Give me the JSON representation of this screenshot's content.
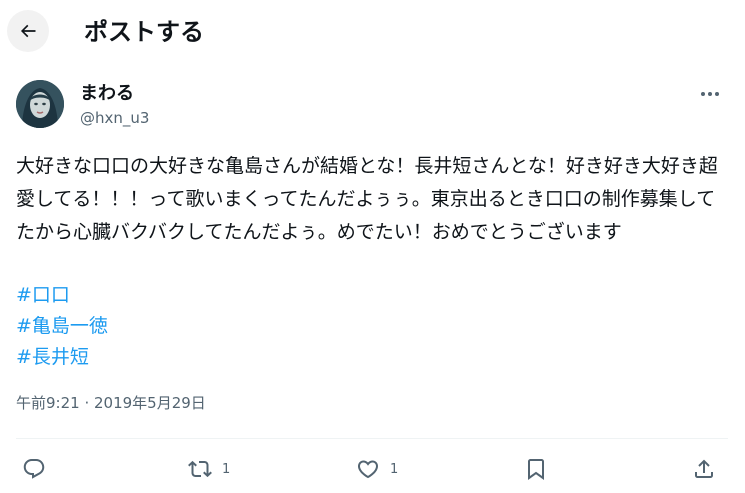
{
  "header": {
    "title": "ポストする",
    "back_icon": "arrow-left-icon"
  },
  "tweet": {
    "display_name": "まわる",
    "handle": "@hxn_u3",
    "text": "大好きな口口の大好きな亀島さんが結婚とな！長井短さんとな！好き好き大好き超愛してる！！！って歌いまくってたんだよぅぅ。東京出るとき口口の制作募集してたから心臓バクバクしてたんだよぅ。めでたい！おめでとうございます",
    "hashtags": [
      "#口口",
      "#亀島一徳",
      "#長井短"
    ],
    "timestamp": "午前9:21 · 2019年5月29日"
  },
  "actions": {
    "reply": {
      "icon": "reply-icon",
      "count": ""
    },
    "repost": {
      "icon": "repost-icon",
      "count": "1"
    },
    "like": {
      "icon": "heart-icon",
      "count": "1"
    },
    "bookmark": {
      "icon": "bookmark-icon",
      "count": ""
    },
    "share": {
      "icon": "share-icon",
      "count": ""
    }
  },
  "colors": {
    "link": "#1d9bf0",
    "secondary_text": "#536471",
    "primary_text": "#0f1419"
  }
}
